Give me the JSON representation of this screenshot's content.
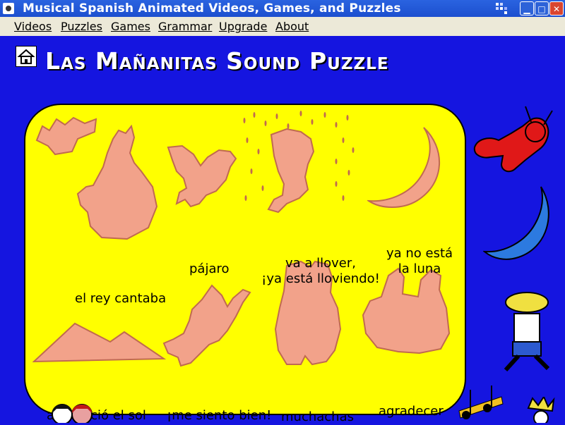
{
  "window": {
    "title": "Musical Spanish Animated Videos, Games, and Puzzles"
  },
  "menu": {
    "items": [
      "Videos",
      "Puzzles",
      "Games",
      "Grammar",
      "Upgrade",
      "About"
    ]
  },
  "page": {
    "title": "Las Mañanitas Sound Puzzle"
  },
  "pieces": [
    {
      "label": "el rey cantaba"
    },
    {
      "label": "pájaro"
    },
    {
      "label_line1": "va a llover,",
      "label_line2": "¡ya está lloviendo!"
    },
    {
      "label_line1": "ya no está",
      "label_line2": "la luna"
    },
    {
      "label": "amaneció el sol"
    },
    {
      "label": "¡me siento bien!"
    },
    {
      "label": "muchachas"
    },
    {
      "label": "agradecer"
    }
  ],
  "colors": {
    "background": "#1515e0",
    "board": "#ffff00",
    "piece": "#f2a28a",
    "titlebar": "#1c4fcf",
    "menubar": "#ece9d8"
  }
}
